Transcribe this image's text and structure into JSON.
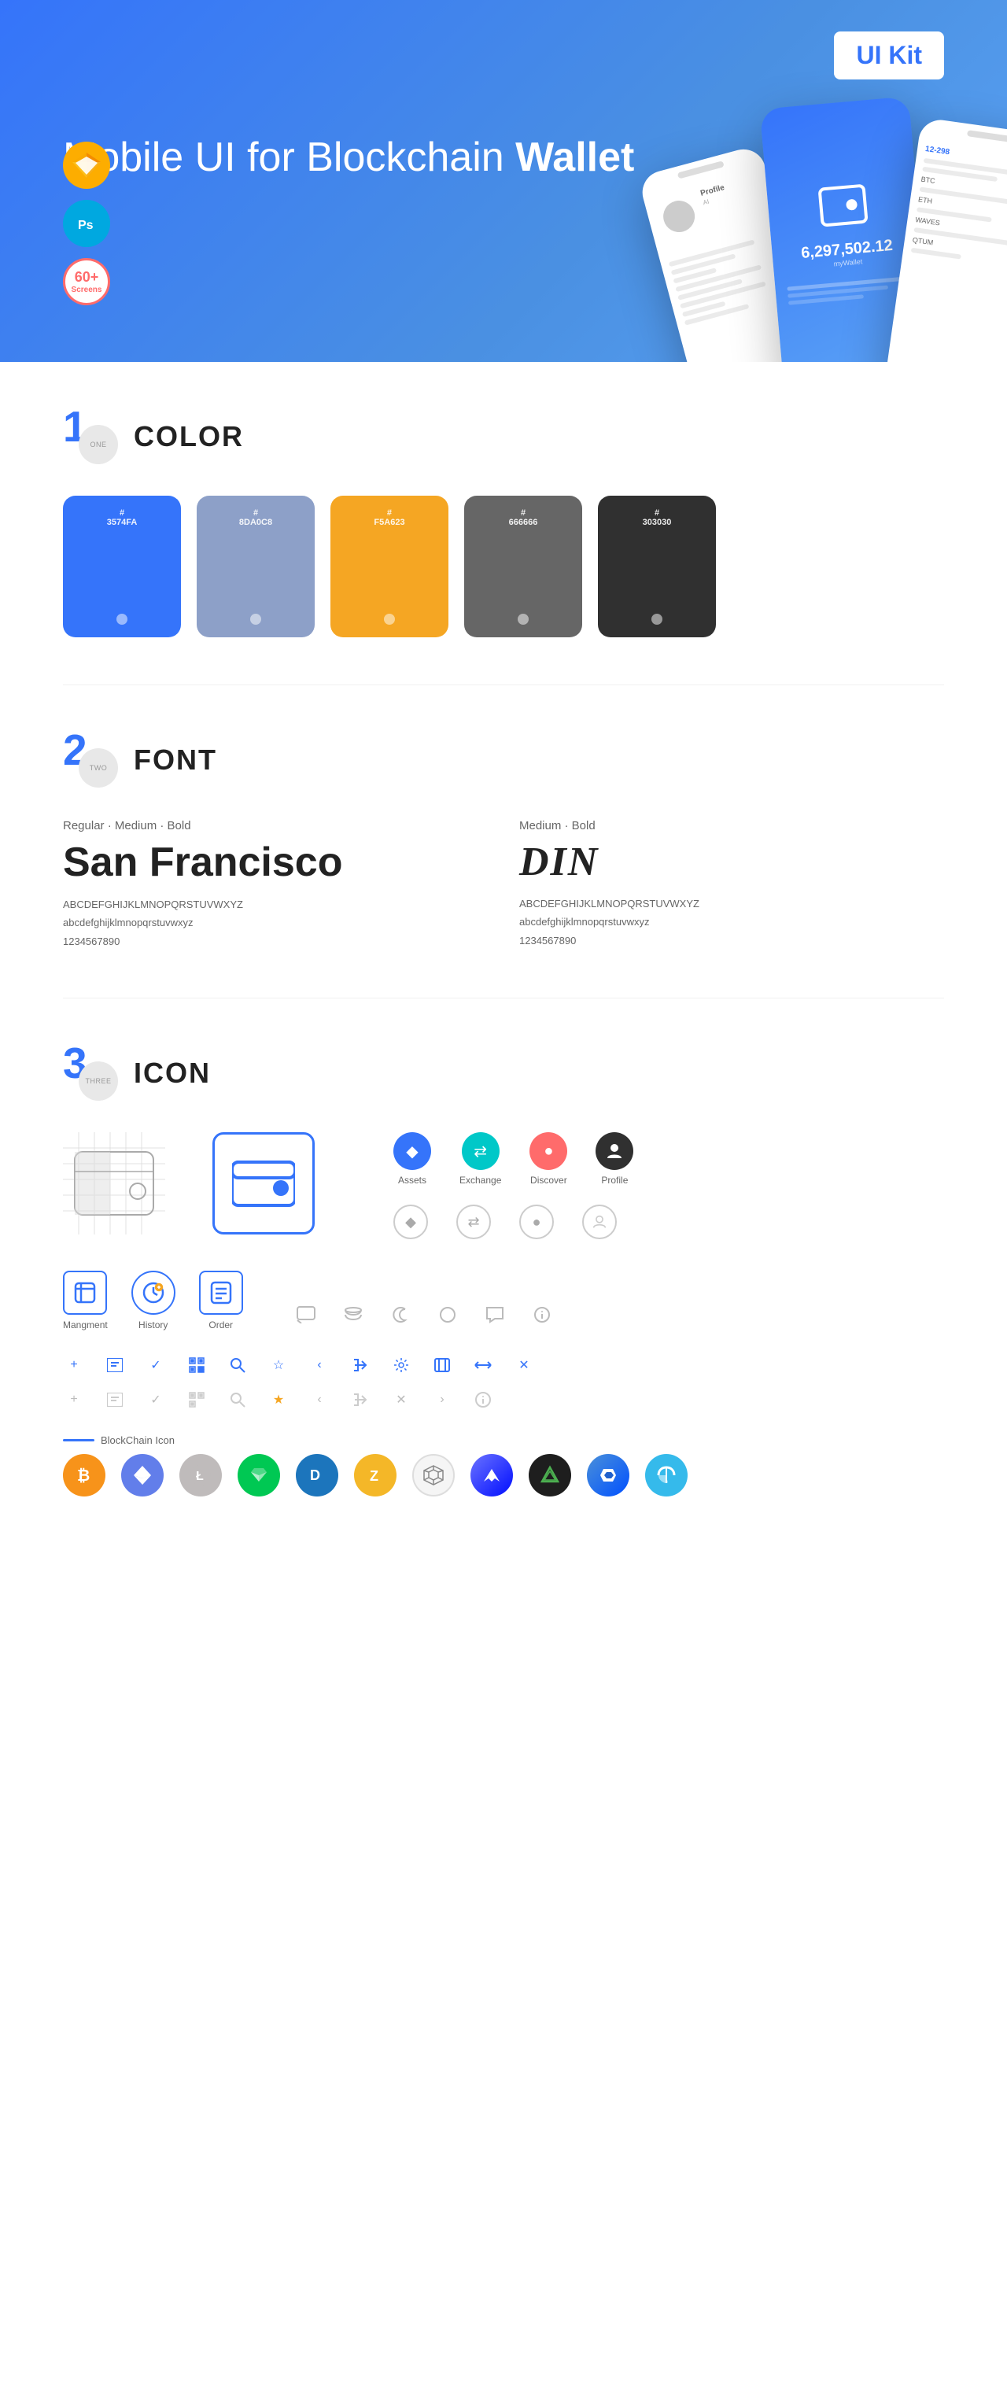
{
  "hero": {
    "title_regular": "Mobile UI for Blockchain ",
    "title_bold": "Wallet",
    "badge": "UI Kit",
    "badges": [
      {
        "name": "Sketch",
        "color": "#FDAD00"
      },
      {
        "name": "Ps",
        "color": "#00A8E0"
      },
      {
        "name": "screens",
        "count": "60+"
      }
    ]
  },
  "sections": {
    "color": {
      "number": "1",
      "word": "ONE",
      "title": "COLOR",
      "swatches": [
        {
          "hex": "#3574FA",
          "label": "#\n3574FA"
        },
        {
          "hex": "#8DA0C8",
          "label": "#\n8DA0C8"
        },
        {
          "hex": "#F5A623",
          "label": "#\nF5A623"
        },
        {
          "hex": "#666666",
          "label": "#\n666666"
        },
        {
          "hex": "#303030",
          "label": "#\n303030"
        }
      ]
    },
    "font": {
      "number": "2",
      "word": "TWO",
      "title": "FONT",
      "fonts": [
        {
          "weights": "Regular · Medium · Bold",
          "name": "San Francisco",
          "uppercase": "ABCDEFGHIJKLMNOPQRSTUVWXYZ",
          "lowercase": "abcdefghijklmnopqrstuvwxyz",
          "numbers": "1234567890"
        },
        {
          "weights": "Medium · Bold",
          "name": "DIN",
          "uppercase": "ABCDEFGHIJKLMNOPQRSTUVWXYZ",
          "lowercase": "abcdefghijklmnopqrstuvwxyz",
          "numbers": "1234567890"
        }
      ]
    },
    "icon": {
      "number": "3",
      "word": "THREE",
      "title": "ICON",
      "nav_icons": [
        {
          "name": "Assets",
          "symbol": "◆",
          "type": "blue"
        },
        {
          "name": "Exchange",
          "symbol": "⇄",
          "type": "cyan"
        },
        {
          "name": "Discover",
          "symbol": "●",
          "type": "red"
        },
        {
          "name": "Profile",
          "symbol": "👤",
          "type": "dark"
        }
      ],
      "app_icons": [
        {
          "name": "Mangment",
          "symbol": "▣"
        },
        {
          "name": "History",
          "symbol": "🕐"
        },
        {
          "name": "Order",
          "symbol": "📋"
        }
      ],
      "tool_icons": [
        "+",
        "⊞",
        "✓",
        "⊡",
        "🔍",
        "☆",
        "‹",
        "«",
        "⚙",
        "⊡",
        "⇄",
        "✕"
      ],
      "blockchain_label": "BlockChain Icon",
      "crypto_icons": [
        {
          "symbol": "₿",
          "class": "btc",
          "name": "Bitcoin"
        },
        {
          "symbol": "Ξ",
          "class": "eth",
          "name": "Ethereum"
        },
        {
          "symbol": "Ł",
          "class": "ltc",
          "name": "Litecoin"
        },
        {
          "symbol": "N",
          "class": "neo",
          "name": "NEO"
        },
        {
          "symbol": "D",
          "class": "dash",
          "name": "Dash"
        },
        {
          "symbol": "Z",
          "class": "zcash",
          "name": "Zcash"
        },
        {
          "symbol": "⬡",
          "class": "grid-coin",
          "name": "Grid"
        },
        {
          "symbol": "A",
          "class": "ardr",
          "name": "Ardor"
        },
        {
          "symbol": "V",
          "class": "vert",
          "name": "Vert"
        },
        {
          "symbol": "G",
          "class": "gnt",
          "name": "GNT"
        },
        {
          "symbol": "~",
          "class": "bts",
          "name": "BTS"
        }
      ]
    }
  }
}
